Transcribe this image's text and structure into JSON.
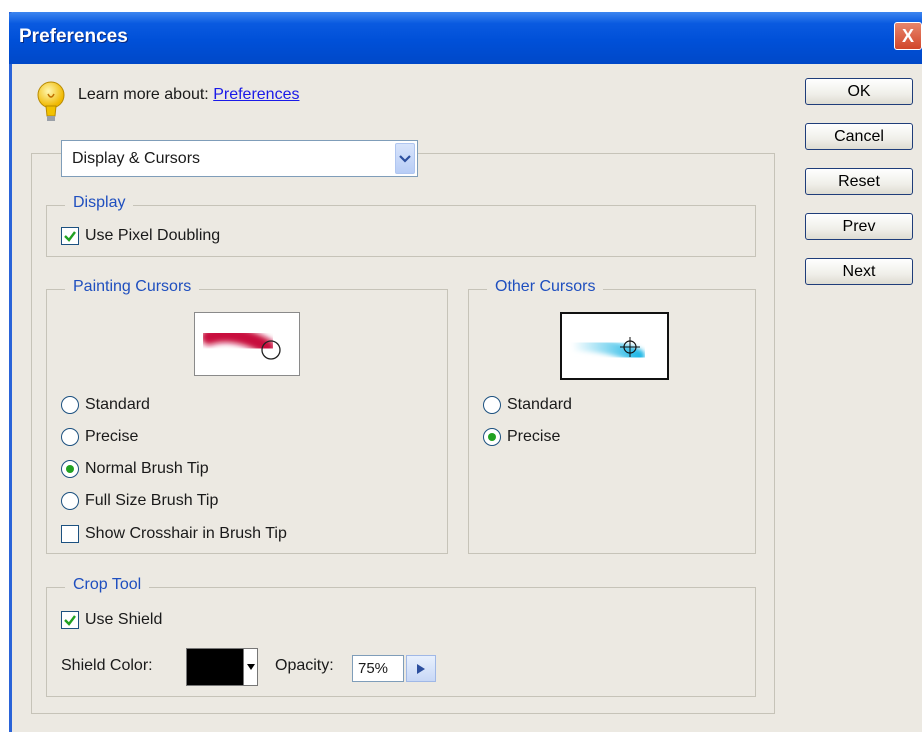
{
  "window": {
    "title": "Preferences",
    "close_glyph": "X"
  },
  "help": {
    "prefix": "Learn more about:",
    "link": "Preferences"
  },
  "buttons": {
    "ok": "OK",
    "cancel": "Cancel",
    "reset": "Reset",
    "prev": "Prev",
    "next": "Next"
  },
  "category_select": {
    "value": "Display & Cursors"
  },
  "display": {
    "legend": "Display",
    "use_pixel_doubling": {
      "label": "Use Pixel Doubling",
      "checked": true
    }
  },
  "painting_cursors": {
    "legend": "Painting Cursors",
    "options": [
      {
        "label": "Standard",
        "selected": false
      },
      {
        "label": "Precise",
        "selected": false
      },
      {
        "label": "Normal Brush Tip",
        "selected": true
      },
      {
        "label": "Full Size Brush Tip",
        "selected": false
      }
    ],
    "crosshair": {
      "label": "Show Crosshair in Brush Tip",
      "checked": false
    }
  },
  "other_cursors": {
    "legend": "Other Cursors",
    "options": [
      {
        "label": "Standard",
        "selected": false
      },
      {
        "label": "Precise",
        "selected": true
      }
    ]
  },
  "crop_tool": {
    "legend": "Crop Tool",
    "use_shield": {
      "label": "Use Shield",
      "checked": true
    },
    "shield_color_label": "Shield Color:",
    "shield_color": "#000000",
    "opacity_label": "Opacity:",
    "opacity_value": "75%"
  },
  "colors": {
    "titlebar": "#0050d8",
    "accent": "#1f4fbf",
    "link": "#1a1ae8",
    "radio_dot": "#21a121"
  }
}
